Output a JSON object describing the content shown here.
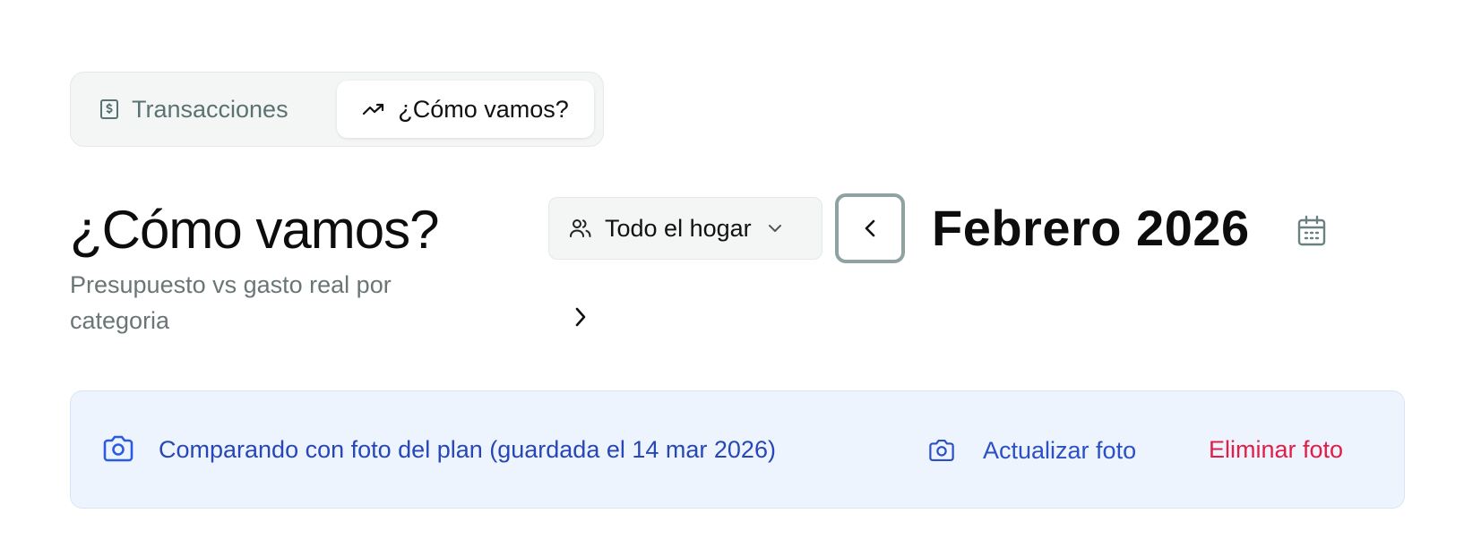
{
  "tabs": [
    {
      "label": "Transacciones",
      "icon": "receipt-icon",
      "active": false
    },
    {
      "label": "¿Cómo vamos?",
      "icon": "trending-up-icon",
      "active": true
    }
  ],
  "header": {
    "title": "¿Cómo vamos?",
    "subtitle": "Presupuesto vs gasto real por categoria"
  },
  "filter": {
    "household_label": "Todo el hogar",
    "icon": "users-icon"
  },
  "period": {
    "month_label": "Febrero 2026",
    "prev_icon": "chevron-left-icon",
    "next_icon": "chevron-right-icon",
    "calendar_icon": "calendar-icon"
  },
  "snapshot_banner": {
    "message": "Comparando con foto del plan (guardada el 14 mar 2026)",
    "update_label": "Actualizar foto",
    "delete_label": "Eliminar foto",
    "icon": "camera-icon"
  },
  "colors": {
    "accent_blue": "#2747b8",
    "danger": "#e11d48",
    "muted": "#6a7676",
    "banner_bg": "#eef4fd"
  }
}
